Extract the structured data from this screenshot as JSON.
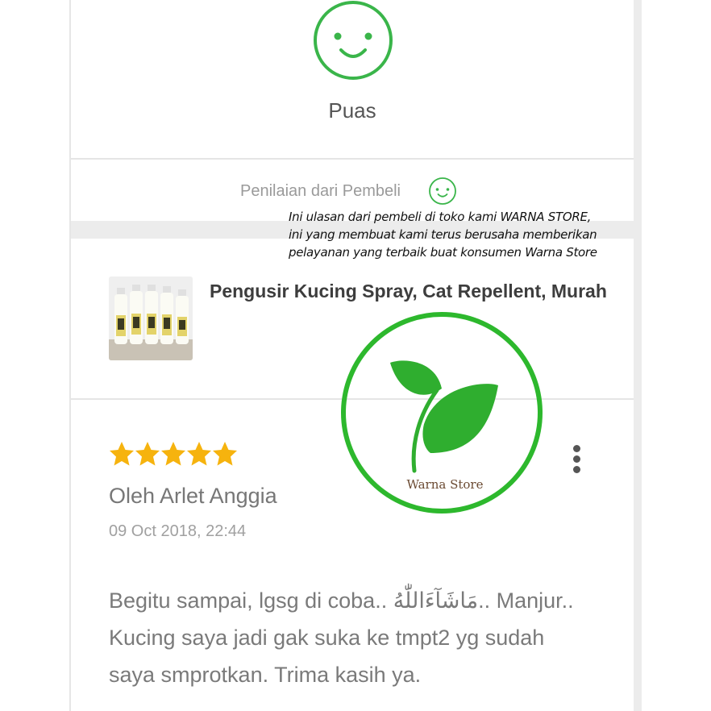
{
  "rating": {
    "label": "Puas",
    "buyer_rating_label": "Penilaian dari Pembeli",
    "face_icon": "smiley-face-icon",
    "accent_color": "#3ab54a"
  },
  "overlay_caption": {
    "lines": [
      "Ini ulasan dari pembeli di toko kami WARNA STORE,",
      "ini yang membuat kami terus berusaha memberikan",
      "pelayanan yang terbaik buat konsumen Warna Store"
    ]
  },
  "product": {
    "title": "Pengusir Kucing Spray, Cat Repellent, Murah",
    "thumbnail": "product-bottles-photo"
  },
  "review": {
    "stars": 5,
    "star_color": "#f6b30e",
    "reviewer": "Oleh Arlet Anggia",
    "date": "09 Oct 2018, 22:44",
    "body_lines": [
      "Begitu sampai, lgsg di coba.. مَاشَآءَاللّٰهُ.. Manjur..",
      "Kucing saya jadi gak suka ke tmpt2 yg sudah",
      "saya smprotkan. Trima kasih ya."
    ],
    "more_icon": "more-vertical-icon"
  },
  "watermark": {
    "brand": "Warna Store",
    "ring_color": "#2db82d",
    "leaf_color": "#2fae2f"
  }
}
